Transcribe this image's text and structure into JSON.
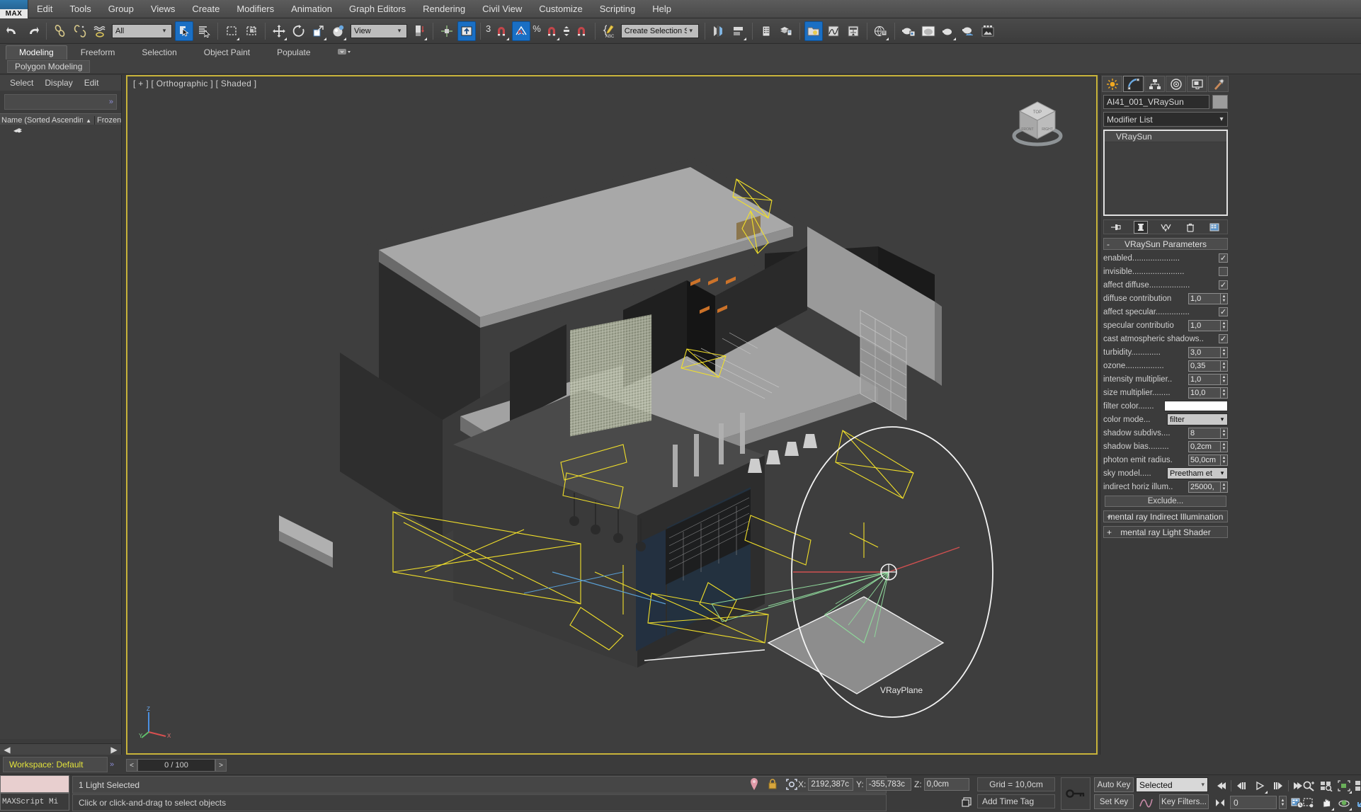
{
  "app": {
    "logo": "MAX"
  },
  "menubar": {
    "items": [
      "Edit",
      "Tools",
      "Group",
      "Views",
      "Create",
      "Modifiers",
      "Animation",
      "Graph Editors",
      "Rendering",
      "Civil View",
      "Customize",
      "Scripting",
      "Help"
    ]
  },
  "main_toolbar": {
    "selection_filter": "All",
    "reference_coord_system": "View",
    "named_selection_sets": "Create Selection Se",
    "snap_count": "3",
    "buttons": [
      {
        "name": "undo-button",
        "icon": "undo-arrow-icon",
        "active": false
      },
      {
        "name": "redo-button",
        "icon": "redo-arrow-icon",
        "active": false
      },
      {
        "name": "select-and-link-button",
        "icon": "link-icon",
        "active": false
      },
      {
        "name": "unlink-selection-button",
        "icon": "unlink-icon",
        "active": false
      },
      {
        "name": "bind-to-space-warp-button",
        "icon": "space-warp-icon",
        "active": false
      },
      {
        "name": "select-object-button",
        "icon": "cursor-arrow-icon",
        "active": true
      },
      {
        "name": "select-by-name-button",
        "icon": "select-by-name-icon",
        "active": false
      },
      {
        "name": "rectangular-selection-region-button",
        "icon": "dashed-rectangle-icon",
        "active": false
      },
      {
        "name": "window-crossing-button",
        "icon": "window-crossing-icon",
        "active": false
      },
      {
        "name": "select-and-move-button",
        "icon": "move-cross-icon",
        "active": false
      },
      {
        "name": "select-and-rotate-button",
        "icon": "rotate-circle-icon",
        "active": false
      },
      {
        "name": "select-and-scale-button",
        "icon": "scale-icon",
        "active": false
      },
      {
        "name": "select-and-place-button",
        "icon": "place-sphere-icon",
        "active": false
      },
      {
        "name": "use-pivot-point-center-button",
        "icon": "pivot-center-icon",
        "active": false
      },
      {
        "name": "use-selection-center-button",
        "icon": "selection-center-icon",
        "active": false
      },
      {
        "name": "mirror-button",
        "icon": "mirror-icon",
        "active": true
      },
      {
        "name": "snaps-toggle-button",
        "icon": "magnet-icon",
        "active": false
      },
      {
        "name": "angle-snap-toggle-button",
        "icon": "angle-snap-icon",
        "active": true
      },
      {
        "name": "percent-snap-toggle-button",
        "icon": "percent-magnet-icon",
        "active": false
      },
      {
        "name": "spinner-snap-toggle-button",
        "icon": "spinner-snap-icon",
        "active": false
      },
      {
        "name": "edit-named-selection-sets-button",
        "icon": "abc-brace-icon",
        "active": false
      },
      {
        "name": "align-button",
        "icon": "align-icon",
        "active": false
      },
      {
        "name": "layer-explorer-button",
        "icon": "layers-icon",
        "active": false
      },
      {
        "name": "toggle-scene-explorer-button",
        "icon": "scene-explorer-icon",
        "active": false
      },
      {
        "name": "toggle-layer-explorer-button",
        "icon": "layer-list-icon",
        "active": false
      },
      {
        "name": "curve-editor-button",
        "icon": "curve-editor-icon",
        "active": false
      },
      {
        "name": "schematic-view-button",
        "icon": "schematic-view-icon",
        "active": false
      },
      {
        "name": "material-editor-button",
        "icon": "teapot-material-icon",
        "active": false
      },
      {
        "name": "render-setup-button",
        "icon": "teapot-render-icon",
        "active": false
      },
      {
        "name": "render-frame-window-button",
        "icon": "teapot-frame-icon",
        "active": false
      },
      {
        "name": "render-production-button",
        "icon": "teapot-production-icon",
        "active": false
      },
      {
        "name": "rendered-frame-window-button",
        "icon": "image-frame-icon",
        "active": false
      }
    ]
  },
  "ribbon": {
    "tabs": [
      {
        "label": "Modeling",
        "active": true
      },
      {
        "label": "Freeform",
        "active": false
      },
      {
        "label": "Selection",
        "active": false
      },
      {
        "label": "Object Paint",
        "active": false
      },
      {
        "label": "Populate",
        "active": false
      }
    ],
    "subtab": "Polygon Modeling"
  },
  "scene_explorer": {
    "menu": [
      "Select",
      "Display",
      "Edit"
    ],
    "search_value": "",
    "columns": [
      "Name (Sorted Ascending)",
      "Frozen"
    ],
    "sort_indicator": "▲",
    "rows": [
      {
        "icon": "layers-stack-icon",
        "label": ""
      }
    ]
  },
  "workspace": {
    "label": "Workspace: Default"
  },
  "viewport": {
    "label": "[ + ] [ Orthographic ] [ Shaded ]",
    "viewcube_faces": {
      "top": "TOP",
      "front": "FRONT",
      "right": "RIGHT"
    },
    "scene_object_label": "VRayPlane",
    "axis_labels": {
      "x": "X",
      "y": "Y",
      "z": "Z"
    },
    "border_color": "#c8b33a"
  },
  "timeline": {
    "frame_display": "0 / 100",
    "prev_label": "<",
    "next_label": ">"
  },
  "command_panel": {
    "tabs": [
      {
        "name": "create-tab",
        "icon": "star-create-icon",
        "active": false
      },
      {
        "name": "modify-tab",
        "icon": "modify-arc-icon",
        "active": true
      },
      {
        "name": "hierarchy-tab",
        "icon": "hierarchy-icon",
        "active": false
      },
      {
        "name": "motion-tab",
        "icon": "motion-wheel-icon",
        "active": false
      },
      {
        "name": "display-tab",
        "icon": "display-monitor-icon",
        "active": false
      },
      {
        "name": "utilities-tab",
        "icon": "hammer-utilities-icon",
        "active": false
      }
    ],
    "object_name": "AI41_001_VRaySun",
    "modifier_list_label": "Modifier List",
    "modifier_stack": [
      "VRaySun"
    ],
    "stack_buttons": [
      {
        "name": "pin-stack-button",
        "icon": "pin-icon",
        "active": false
      },
      {
        "name": "show-end-result-button",
        "icon": "show-end-result-icon",
        "active": true
      },
      {
        "name": "make-unique-button",
        "icon": "make-unique-icon",
        "active": false
      },
      {
        "name": "remove-modifier-button",
        "icon": "trash-icon",
        "active": false
      },
      {
        "name": "configure-modifier-sets-button",
        "icon": "configure-sets-icon",
        "active": false
      }
    ],
    "rollouts": [
      {
        "title": "VRaySun Parameters",
        "state": "open",
        "toggle": "-",
        "params": [
          {
            "name": "enabled",
            "label": "enabled.....................",
            "type": "check",
            "value": true
          },
          {
            "name": "invisible",
            "label": "invisible.......................",
            "type": "check",
            "value": false
          },
          {
            "name": "affect-diffuse",
            "label": "affect diffuse..................",
            "type": "check",
            "value": true
          },
          {
            "name": "diffuse-contribution",
            "label": "diffuse contribution",
            "type": "spinner",
            "value": "1,0"
          },
          {
            "name": "affect-specular",
            "label": "affect specular...............",
            "type": "check",
            "value": true
          },
          {
            "name": "specular-contribution",
            "label": "specular contributio",
            "type": "spinner",
            "value": "1,0"
          },
          {
            "name": "cast-atmospheric-shadows",
            "label": "cast atmospheric shadows..",
            "type": "check",
            "value": true
          },
          {
            "name": "turbidity",
            "label": "turbidity.............",
            "type": "spinner",
            "value": "3,0"
          },
          {
            "name": "ozone",
            "label": "ozone.................",
            "type": "spinner",
            "value": "0,35"
          },
          {
            "name": "intensity-multiplier",
            "label": "intensity multiplier..",
            "type": "spinner",
            "value": "1,0"
          },
          {
            "name": "size-multiplier",
            "label": "size multiplier........",
            "type": "spinner",
            "value": "10,0"
          },
          {
            "name": "filter-color",
            "label": "filter color.......",
            "type": "color",
            "value": "#ffffff"
          },
          {
            "name": "color-mode",
            "label": "color mode...",
            "type": "combo",
            "value": "filter"
          },
          {
            "name": "shadow-subdivs",
            "label": "shadow subdivs....",
            "type": "spinner",
            "value": "8"
          },
          {
            "name": "shadow-bias",
            "label": "shadow bias.........",
            "type": "spinner",
            "value": "0,2cm"
          },
          {
            "name": "photon-emit-radius",
            "label": "photon emit radius.",
            "type": "spinner",
            "value": "50,0cm"
          },
          {
            "name": "sky-model",
            "label": "sky model.....",
            "type": "combo",
            "value": "Preetham et"
          },
          {
            "name": "indirect-horiz-illum",
            "label": "indirect horiz illum..",
            "type": "spinner",
            "value": "25000,"
          }
        ],
        "button": "Exclude..."
      },
      {
        "title": "mental ray Indirect Illumination",
        "state": "closed",
        "toggle": "+"
      },
      {
        "title": "mental ray Light Shader",
        "state": "closed",
        "toggle": "+"
      }
    ]
  },
  "status_bar": {
    "maxscript_label": "MAXScript Mi",
    "selection_status": "1 Light Selected",
    "prompt": "Click or click-and-drag to select objects",
    "coords": [
      {
        "axis": "X:",
        "value": "2192,387c"
      },
      {
        "axis": "Y:",
        "value": "-355,783c"
      },
      {
        "axis": "Z:",
        "value": "0,0cm"
      }
    ],
    "grid": "Grid = 10,0cm",
    "add_time_tag": "Add Time Tag",
    "auto_key": "Auto Key",
    "set_key": "Set Key",
    "key_mode": "Selected",
    "key_filters": "Key Filters...",
    "current_frame": "0",
    "icons": [
      {
        "name": "isolate-selection-icon"
      },
      {
        "name": "lock-selection-icon"
      },
      {
        "name": "selection-lock-toggle-icon"
      },
      {
        "name": "key-toggle-icon"
      }
    ],
    "anim_buttons": [
      {
        "name": "go-to-start-button",
        "icon": "skip-start-icon"
      },
      {
        "name": "previous-frame-button",
        "icon": "step-back-icon"
      },
      {
        "name": "play-animation-button",
        "icon": "play-icon"
      },
      {
        "name": "next-frame-button",
        "icon": "step-forward-icon"
      },
      {
        "name": "go-to-end-button",
        "icon": "skip-end-icon"
      },
      {
        "name": "key-mode-toggle-button",
        "icon": "key-mode-icon"
      }
    ],
    "nav_buttons": [
      {
        "name": "zoom-button",
        "icon": "zoom-magnifier-icon"
      },
      {
        "name": "zoom-all-button",
        "icon": "zoom-all-icon"
      },
      {
        "name": "zoom-extents-button",
        "icon": "zoom-extents-icon"
      },
      {
        "name": "zoom-extents-all-button",
        "icon": "zoom-extents-all-icon"
      },
      {
        "name": "time-configuration-button",
        "icon": "time-config-icon"
      },
      {
        "name": "field-of-view-button",
        "icon": "field-of-view-icon"
      },
      {
        "name": "pan-view-button",
        "icon": "hand-pan-icon"
      },
      {
        "name": "orbit-button",
        "icon": "orbit-icon"
      },
      {
        "name": "maximize-viewport-button",
        "icon": "maximize-viewport-icon"
      }
    ]
  }
}
